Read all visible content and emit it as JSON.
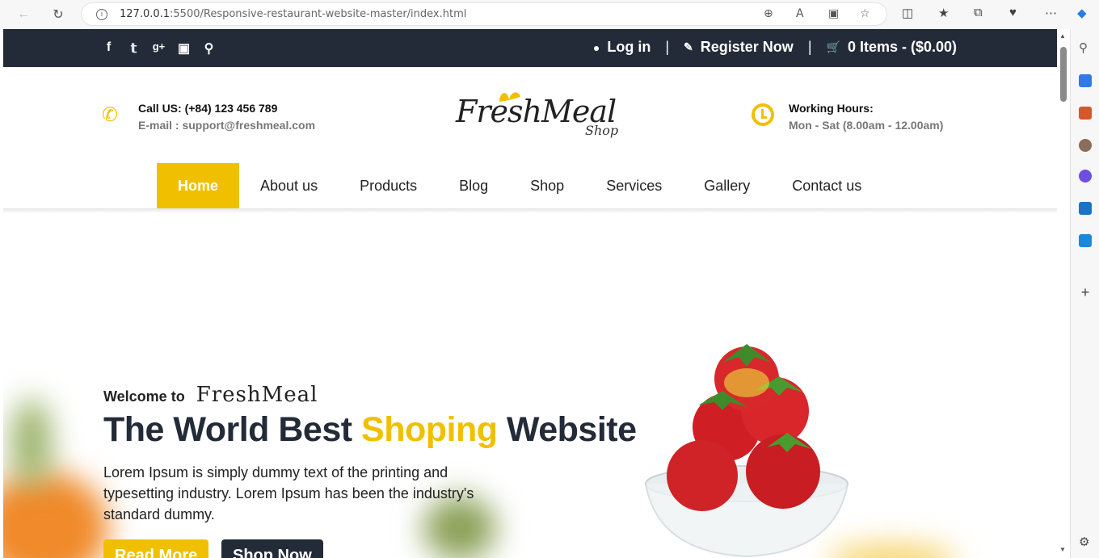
{
  "browser": {
    "url_host": "127.0.0.1",
    "url_rest": ":5500/Responsive-restaurant-website-master/index.html"
  },
  "topbar": {
    "social_icons": [
      "facebook-icon",
      "twitter-icon",
      "google-plus-icon",
      "instagram-icon",
      "search-icon"
    ],
    "login": "Log in",
    "register": "Register Now",
    "cart": "0 Items - ($0.00)"
  },
  "header": {
    "call_label": "Call US: (+84) 123 456 789",
    "email_label": "E-mail : support@freshmeal.com",
    "logo_main": "FreshMeal",
    "logo_sub": "Shop",
    "hours_title": "Working Hours:",
    "hours_value": "Mon - Sat (8.00am - 12.00am)"
  },
  "menu": {
    "items": [
      {
        "label": "Home"
      },
      {
        "label": "About us"
      },
      {
        "label": "Products"
      },
      {
        "label": "Blog"
      },
      {
        "label": "Shop"
      },
      {
        "label": "Services"
      },
      {
        "label": "Gallery"
      },
      {
        "label": "Contact us"
      }
    ],
    "active_index": 0
  },
  "hero": {
    "welcome": "Welcome to",
    "brand": "FreshMeal",
    "headline_a": "The World Best ",
    "headline_hl": "Shoping",
    "headline_b": " Website",
    "description": "Lorem Ipsum is simply dummy text of the printing and typesetting industry. Lorem Ipsum has been the industry's standard dummy.",
    "read_more": "Read More",
    "shop_now": "Shop Now"
  },
  "colors": {
    "accent": "#f0c000",
    "dark": "#232b38"
  }
}
